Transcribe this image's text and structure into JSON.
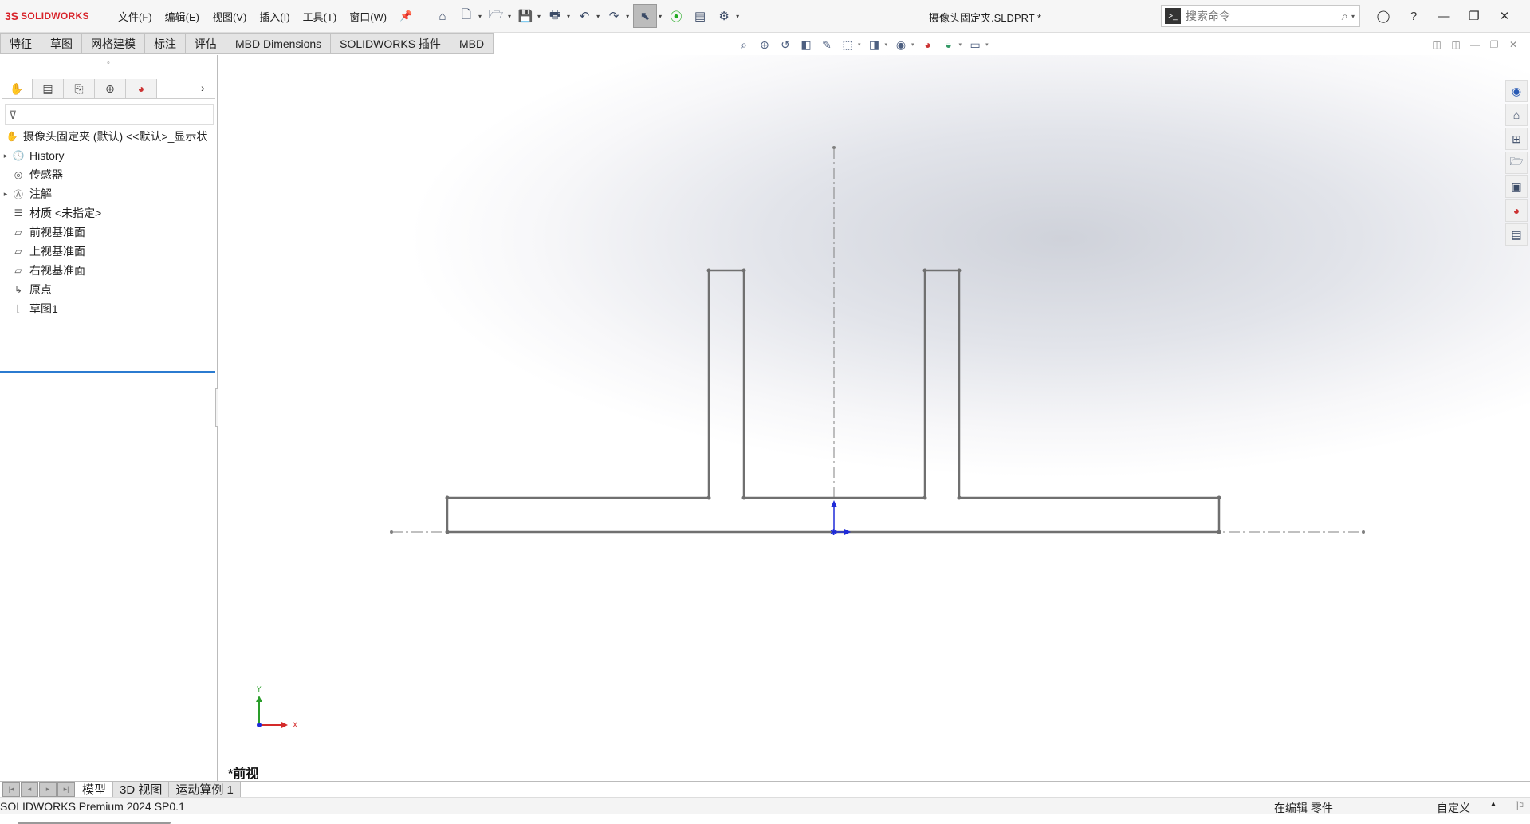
{
  "app": {
    "logo_mark": "3S",
    "logo_text": "SOLIDWORKS",
    "document_title": "摄像头固定夹.SLDPRT *"
  },
  "menu": [
    "文件(F)",
    "编辑(E)",
    "视图(V)",
    "插入(I)",
    "工具(T)",
    "窗口(W)"
  ],
  "search": {
    "placeholder": "搜索命令"
  },
  "command_tabs": [
    "特征",
    "草图",
    "网格建模",
    "标注",
    "评估",
    "MBD Dimensions",
    "SOLIDWORKS 插件",
    "MBD"
  ],
  "tree": {
    "root": "摄像头固定夹 (默认) <<默认>_显示状",
    "items": [
      {
        "label": "History",
        "icon": "history-icon",
        "expandable": true
      },
      {
        "label": "传感器",
        "icon": "sensor-icon",
        "expandable": false
      },
      {
        "label": "注解",
        "icon": "annotation-icon",
        "expandable": true
      },
      {
        "label": "材质 <未指定>",
        "icon": "material-icon",
        "expandable": false
      },
      {
        "label": "前视基准面",
        "icon": "plane-icon",
        "expandable": false
      },
      {
        "label": "上视基准面",
        "icon": "plane-icon",
        "expandable": false
      },
      {
        "label": "右视基准面",
        "icon": "plane-icon",
        "expandable": false
      },
      {
        "label": "原点",
        "icon": "origin-icon",
        "expandable": false
      },
      {
        "label": "草图1",
        "icon": "sketch-icon",
        "expandable": false
      }
    ]
  },
  "viewport": {
    "view_name": "*前视",
    "axis_x": "X",
    "axis_y": "Y",
    "colors": {
      "sketch_line": "#707070",
      "centerline": "#808080",
      "origin": "#1f2bd8"
    }
  },
  "bottom_tabs": [
    "模型",
    "3D 视图",
    "运动算例 1"
  ],
  "status": {
    "left": "SOLIDWORKS Premium 2024 SP0.1",
    "mode": "在编辑 零件",
    "units": "自定义",
    "caret": "▲"
  }
}
